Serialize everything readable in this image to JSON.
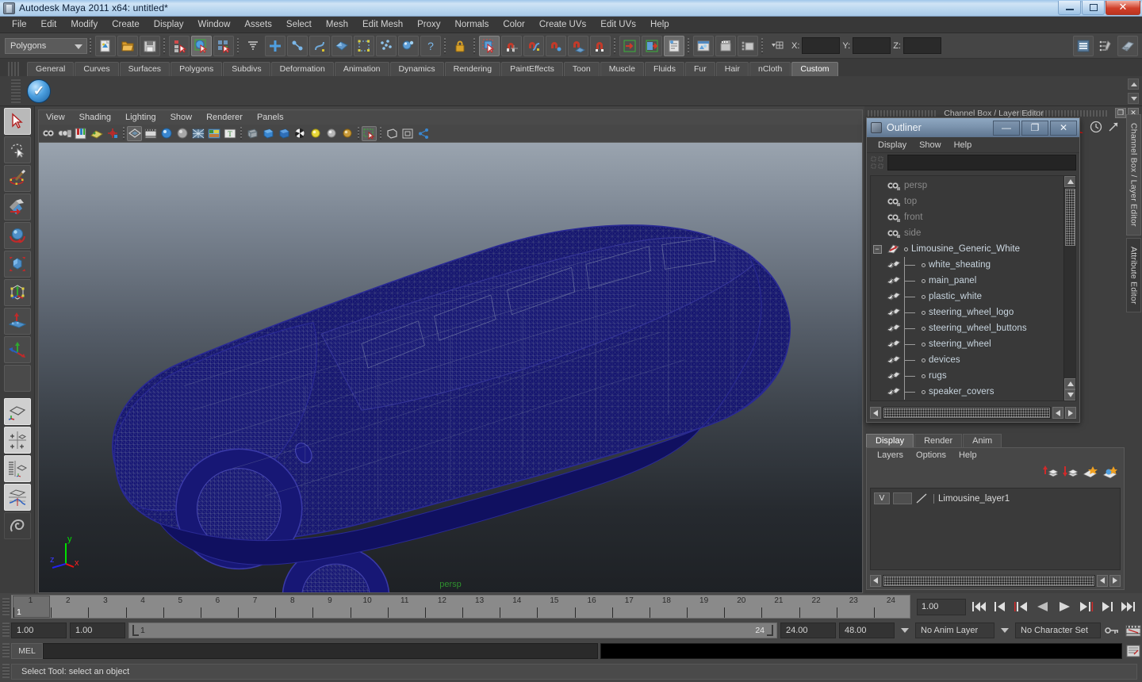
{
  "window": {
    "title": "Autodesk Maya 2011 x64: untitled*",
    "minimize": "—",
    "maximize": "❐",
    "close": "✕"
  },
  "menubar": {
    "items": [
      "File",
      "Edit",
      "Modify",
      "Create",
      "Display",
      "Window",
      "Assets",
      "Select",
      "Mesh",
      "Edit Mesh",
      "Proxy",
      "Normals",
      "Color",
      "Create UVs",
      "Edit UVs",
      "Help"
    ]
  },
  "statusline": {
    "mode": "Polygons",
    "x_label": "X:",
    "y_label": "Y:",
    "z_label": "Z:",
    "x_value": "",
    "y_value": "",
    "z_value": ""
  },
  "shelf": {
    "tabs": [
      "General",
      "Curves",
      "Surfaces",
      "Polygons",
      "Subdivs",
      "Deformation",
      "Animation",
      "Dynamics",
      "Rendering",
      "PaintEffects",
      "Toon",
      "Muscle",
      "Fluids",
      "Fur",
      "Hair",
      "nCloth",
      "Custom"
    ],
    "active_tab": "Custom"
  },
  "viewport": {
    "menu": [
      "View",
      "Shading",
      "Lighting",
      "Show",
      "Renderer",
      "Panels"
    ],
    "camera_label": "persp",
    "axis": {
      "x": "x",
      "y": "y",
      "z": "z"
    },
    "model_name": "Limousine_Generic_White",
    "wireframe_color": "#1a1a8c",
    "bg_top": "#9aa4af",
    "bg_bottom": "#1e2125"
  },
  "channelbox": {
    "header": "Channel Box / Layer Editor",
    "restore": "❐",
    "close": "✕"
  },
  "outliner": {
    "title": "Outliner",
    "minimize": "—",
    "maximize": "❐",
    "close": "✕",
    "menu": [
      "Display",
      "Show",
      "Help"
    ],
    "search_value": "",
    "search_placeholder": "",
    "items": [
      {
        "label": "persp",
        "type": "camera",
        "depth": 0
      },
      {
        "label": "top",
        "type": "camera",
        "depth": 0
      },
      {
        "label": "front",
        "type": "camera",
        "depth": 0
      },
      {
        "label": "side",
        "type": "camera",
        "depth": 0
      },
      {
        "label": "Limousine_Generic_White",
        "type": "group",
        "depth": 0,
        "expanded": true,
        "expand_glyph": "−"
      },
      {
        "label": "white_sheating",
        "type": "mesh",
        "depth": 1
      },
      {
        "label": "main_panel",
        "type": "mesh",
        "depth": 1
      },
      {
        "label": "plastic_white",
        "type": "mesh",
        "depth": 1
      },
      {
        "label": "steering_wheel_logo",
        "type": "mesh",
        "depth": 1
      },
      {
        "label": "steering_wheel_buttons",
        "type": "mesh",
        "depth": 1
      },
      {
        "label": "steering_wheel",
        "type": "mesh",
        "depth": 1
      },
      {
        "label": "devices",
        "type": "mesh",
        "depth": 1
      },
      {
        "label": "rugs",
        "type": "mesh",
        "depth": 1
      },
      {
        "label": "speaker_covers",
        "type": "mesh",
        "depth": 1
      }
    ]
  },
  "layer_editor": {
    "tabs": [
      "Display",
      "Render",
      "Anim"
    ],
    "active_tab": "Display",
    "menu": [
      "Layers",
      "Options",
      "Help"
    ],
    "layers": [
      {
        "visibility": "V",
        "playback": "",
        "name": "Limousine_layer1"
      }
    ]
  },
  "side_tabs": {
    "items": [
      "Channel Box / Layer Editor",
      "Attribute Editor"
    ],
    "active": "Attribute Editor"
  },
  "timeline": {
    "frames": [
      "1",
      "2",
      "3",
      "4",
      "5",
      "6",
      "7",
      "8",
      "9",
      "10",
      "11",
      "12",
      "13",
      "14",
      "15",
      "16",
      "17",
      "18",
      "19",
      "20",
      "21",
      "22",
      "23",
      "24"
    ],
    "current_frame": "1",
    "current_frame_field": "1.00",
    "playback_buttons": [
      "go-to-start",
      "step-back-key",
      "step-back-frame",
      "play-backwards",
      "play-forwards",
      "step-forward-frame",
      "step-forward-key",
      "go-to-end"
    ]
  },
  "range_slider": {
    "start_field": "1.00",
    "end_field": "1.00",
    "range_start": "1",
    "range_end": "24",
    "anim_start": "24.00",
    "anim_end": "48.00",
    "anim_layer": "No Anim Layer",
    "character_set": "No Character Set"
  },
  "command_line": {
    "language": "MEL",
    "input_value": "",
    "output_value": ""
  },
  "help_line": {
    "text": "Select Tool: select an object"
  },
  "toolbox": {
    "items": [
      "select-tool",
      "lasso-tool",
      "paint-select-tool",
      "move-tool",
      "rotate-tool",
      "scale-tool",
      "universal-manipulator",
      "soft-modification-tool",
      "last-tool",
      "blank-slot",
      "single-pane-layout",
      "four-pane-layout",
      "outliner-persp-layout",
      "persp-graph-layout",
      "maya-logo"
    ]
  }
}
